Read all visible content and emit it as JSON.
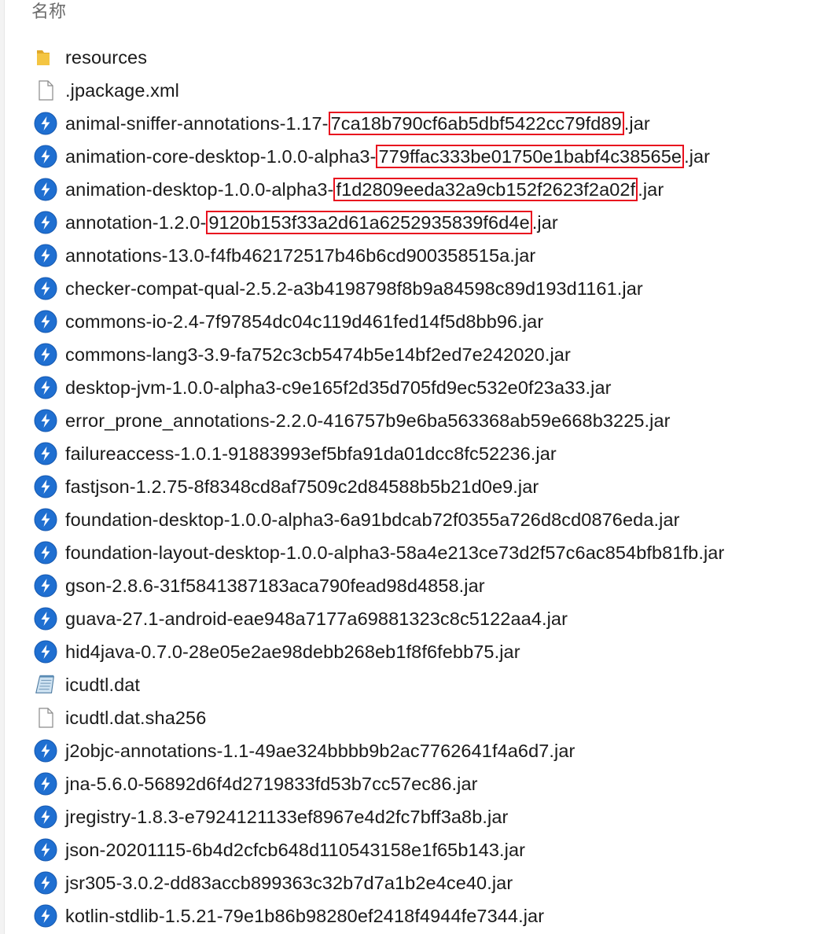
{
  "header": {
    "name_column": "名称"
  },
  "colors": {
    "highlight": "#e8101e",
    "jar_icon": "#1f6fd1",
    "folder": "#f4c542"
  },
  "files": [
    {
      "icon": "folder-icon",
      "parts": [
        {
          "text": "resources"
        }
      ]
    },
    {
      "icon": "document-icon",
      "parts": [
        {
          "text": ".jpackage.xml"
        }
      ]
    },
    {
      "icon": "jar-icon",
      "parts": [
        {
          "text": "animal-sniffer-annotations-1.17-"
        },
        {
          "text": "7ca18b790cf6ab5dbf5422cc79fd89",
          "hl": true
        },
        {
          "text": ".jar"
        }
      ]
    },
    {
      "icon": "jar-icon",
      "parts": [
        {
          "text": "animation-core-desktop-1.0.0-alpha3-"
        },
        {
          "text": "779ffac333be01750e1babf4c38565e",
          "hl": true
        },
        {
          "text": ".jar"
        }
      ]
    },
    {
      "icon": "jar-icon",
      "parts": [
        {
          "text": "animation-desktop-1.0.0-alpha3-"
        },
        {
          "text": "f1d2809eeda32a9cb152f2623f2a02f",
          "hl": true
        },
        {
          "text": ".jar"
        }
      ]
    },
    {
      "icon": "jar-icon",
      "parts": [
        {
          "text": "annotation-1.2.0-"
        },
        {
          "text": "9120b153f33a2d61a6252935839f6d4e",
          "hl": true
        },
        {
          "text": ".jar"
        }
      ]
    },
    {
      "icon": "jar-icon",
      "parts": [
        {
          "text": "annotations-13.0-f4fb462172517b46b6cd900358515a.jar"
        }
      ]
    },
    {
      "icon": "jar-icon",
      "parts": [
        {
          "text": "checker-compat-qual-2.5.2-a3b4198798f8b9a84598c89d193d1161.jar"
        }
      ]
    },
    {
      "icon": "jar-icon",
      "parts": [
        {
          "text": "commons-io-2.4-7f97854dc04c119d461fed14f5d8bb96.jar"
        }
      ]
    },
    {
      "icon": "jar-icon",
      "parts": [
        {
          "text": "commons-lang3-3.9-fa752c3cb5474b5e14bf2ed7e242020.jar"
        }
      ]
    },
    {
      "icon": "jar-icon",
      "parts": [
        {
          "text": "desktop-jvm-1.0.0-alpha3-c9e165f2d35d705fd9ec532e0f23a33.jar"
        }
      ]
    },
    {
      "icon": "jar-icon",
      "parts": [
        {
          "text": "error_prone_annotations-2.2.0-416757b9e6ba563368ab59e668b3225.jar"
        }
      ]
    },
    {
      "icon": "jar-icon",
      "parts": [
        {
          "text": "failureaccess-1.0.1-91883993ef5bfa91da01dcc8fc52236.jar"
        }
      ]
    },
    {
      "icon": "jar-icon",
      "parts": [
        {
          "text": "fastjson-1.2.75-8f8348cd8af7509c2d84588b5b21d0e9.jar"
        }
      ]
    },
    {
      "icon": "jar-icon",
      "parts": [
        {
          "text": "foundation-desktop-1.0.0-alpha3-6a91bdcab72f0355a726d8cd0876eda.jar"
        }
      ]
    },
    {
      "icon": "jar-icon",
      "parts": [
        {
          "text": "foundation-layout-desktop-1.0.0-alpha3-58a4e213ce73d2f57c6ac854bfb81fb.jar"
        }
      ]
    },
    {
      "icon": "jar-icon",
      "parts": [
        {
          "text": "gson-2.8.6-31f5841387183aca790fead98d4858.jar"
        }
      ]
    },
    {
      "icon": "jar-icon",
      "parts": [
        {
          "text": "guava-27.1-android-eae948a7177a69881323c8c5122aa4.jar"
        }
      ]
    },
    {
      "icon": "jar-icon",
      "parts": [
        {
          "text": "hid4java-0.7.0-28e05e2ae98debb268eb1f8f6febb75.jar"
        }
      ]
    },
    {
      "icon": "notepad-icon",
      "parts": [
        {
          "text": "icudtl.dat"
        }
      ]
    },
    {
      "icon": "document-icon",
      "parts": [
        {
          "text": "icudtl.dat.sha256"
        }
      ]
    },
    {
      "icon": "jar-icon",
      "parts": [
        {
          "text": "j2objc-annotations-1.1-49ae324bbbb9b2ac7762641f4a6d7.jar"
        }
      ]
    },
    {
      "icon": "jar-icon",
      "parts": [
        {
          "text": "jna-5.6.0-56892d6f4d2719833fd53b7cc57ec86.jar"
        }
      ]
    },
    {
      "icon": "jar-icon",
      "parts": [
        {
          "text": "jregistry-1.8.3-e7924121133ef8967e4d2fc7bff3a8b.jar"
        }
      ]
    },
    {
      "icon": "jar-icon",
      "parts": [
        {
          "text": "json-20201115-6b4d2cfcb648d110543158e1f65b143.jar"
        }
      ]
    },
    {
      "icon": "jar-icon",
      "parts": [
        {
          "text": "jsr305-3.0.2-dd83accb899363c32b7d7a1b2e4ce40.jar"
        }
      ]
    },
    {
      "icon": "jar-icon",
      "parts": [
        {
          "text": "kotlin-stdlib-1.5.21-79e1b86b98280ef2418f4944fe7344.jar"
        }
      ]
    }
  ]
}
